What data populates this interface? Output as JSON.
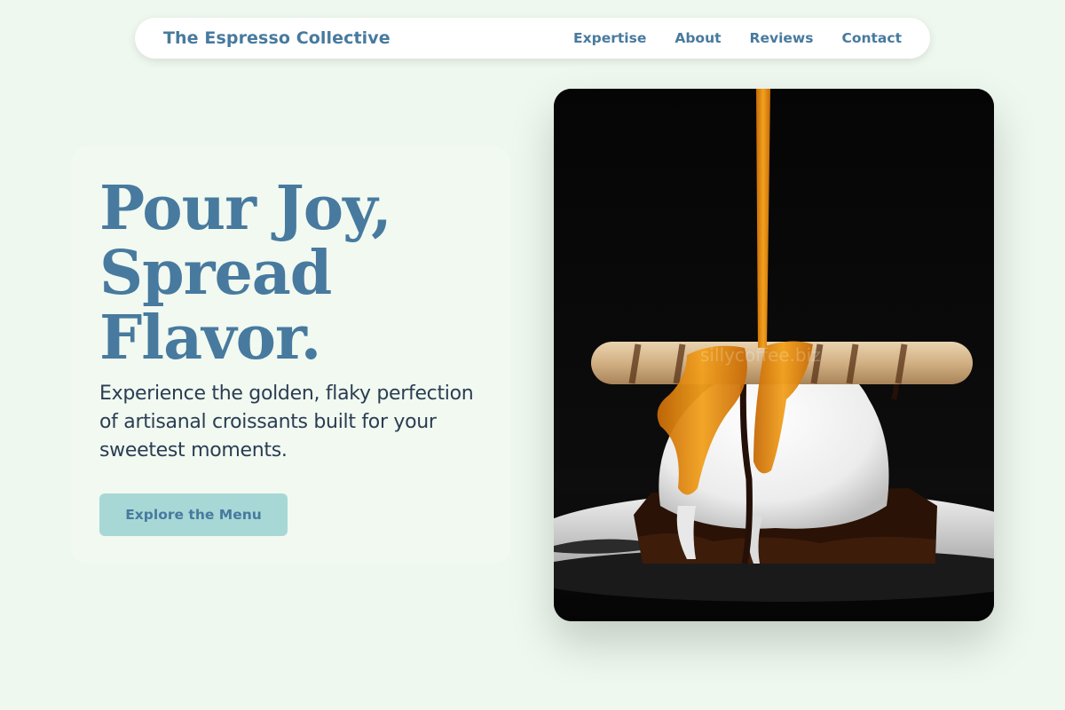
{
  "nav": {
    "brand": "The Espresso Collective",
    "links": [
      "Expertise",
      "About",
      "Reviews",
      "Contact"
    ]
  },
  "hero": {
    "headline_lines": [
      "Pour Joy,",
      "Spread",
      "Flavor."
    ],
    "subtitle": "Experience the golden, flaky perfection of artisanal croissants built for your sweetest moments.",
    "cta_label": "Explore the Menu",
    "image_alt": "Caramel drizzled over ice cream on a brownie with a wafer roll"
  },
  "colors": {
    "background": "#eef8ee",
    "accent": "#477a9e",
    "button_bg": "#a8d8d6",
    "text_dark": "#2a3d52"
  }
}
